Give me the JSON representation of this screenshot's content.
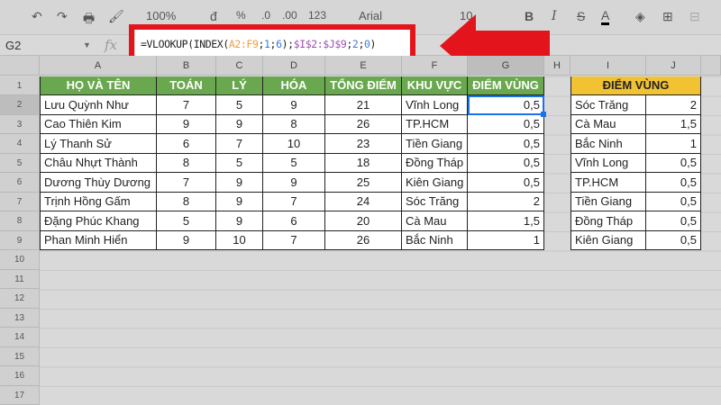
{
  "toolbar": {
    "zoom": "100%",
    "currency": "đ",
    "percent": "%",
    "dec_less": ".0",
    "dec_more": ".00",
    "format": "123",
    "font": "Arial",
    "font_size": "10"
  },
  "formula_bar": {
    "name_box": "G2",
    "fx": "fx",
    "formula_parts": [
      [
        "=VLOOKUP(INDEX(",
        "#222"
      ],
      [
        "A2:F9",
        "#f39c38"
      ],
      [
        ";",
        "#222"
      ],
      [
        "1",
        "#3b78e7"
      ],
      [
        ";",
        "#222"
      ],
      [
        "6",
        "#3b78e7"
      ],
      [
        ");",
        "#222"
      ],
      [
        "$I$2:$J$9",
        "#9c4fb0"
      ],
      [
        ";",
        "#222"
      ],
      [
        "2",
        "#3b78e7"
      ],
      [
        ";",
        "#222"
      ],
      [
        "0",
        "#3b78e7"
      ],
      [
        ")",
        "#222"
      ]
    ]
  },
  "columns": [
    "A",
    "B",
    "C",
    "D",
    "E",
    "F",
    "G",
    "H",
    "I",
    "J"
  ],
  "rows": [
    "1",
    "2",
    "3",
    "4",
    "5",
    "6",
    "7",
    "8",
    "9",
    "10",
    "11",
    "12",
    "13",
    "14",
    "15",
    "16",
    "17"
  ],
  "table": {
    "headers": [
      "HỌ VÀ TÊN",
      "TOÁN",
      "LÝ",
      "HÓA",
      "TỔNG ĐIỂM",
      "KHU VỰC",
      "ĐIỂM VÙNG"
    ],
    "rows": [
      [
        "Lưu Quỳnh Như",
        "7",
        "5",
        "9",
        "21",
        "Vĩnh Long",
        "0,5"
      ],
      [
        "Cao Thiên Kim",
        "9",
        "9",
        "8",
        "26",
        "TP.HCM",
        "0,5"
      ],
      [
        "Lý Thanh Sử",
        "6",
        "7",
        "10",
        "23",
        "Tiền Giang",
        "0,5"
      ],
      [
        "Châu Nhựt Thành",
        "8",
        "5",
        "5",
        "18",
        "Đồng Tháp",
        "0,5"
      ],
      [
        "Dương Thùy Dương",
        "7",
        "9",
        "9",
        "25",
        "Kiên Giang",
        "0,5"
      ],
      [
        "Trịnh Hồng Gấm",
        "8",
        "9",
        "7",
        "24",
        "Sóc Trăng",
        "2"
      ],
      [
        "Đặng Phúc Khang",
        "5",
        "9",
        "6",
        "20",
        "Cà Mau",
        "1,5"
      ],
      [
        "Phan Minh Hiển",
        "9",
        "10",
        "7",
        "26",
        "Bắc Ninh",
        "1"
      ]
    ]
  },
  "lookup": {
    "header": "ĐIỂM VÙNG",
    "rows": [
      [
        "Sóc Trăng",
        "2"
      ],
      [
        "Cà Mau",
        "1,5"
      ],
      [
        "Bắc Ninh",
        "1"
      ],
      [
        "Vĩnh Long",
        "0,5"
      ],
      [
        "TP.HCM",
        "0,5"
      ],
      [
        "Tiền Giang",
        "0,5"
      ],
      [
        "Đồng Tháp",
        "0,5"
      ],
      [
        "Kiên Giang",
        "0,5"
      ]
    ]
  },
  "colors": {
    "header_green": "#6aa84f",
    "header_yellow": "#f1c232",
    "annotation_red": "#e3141b"
  }
}
